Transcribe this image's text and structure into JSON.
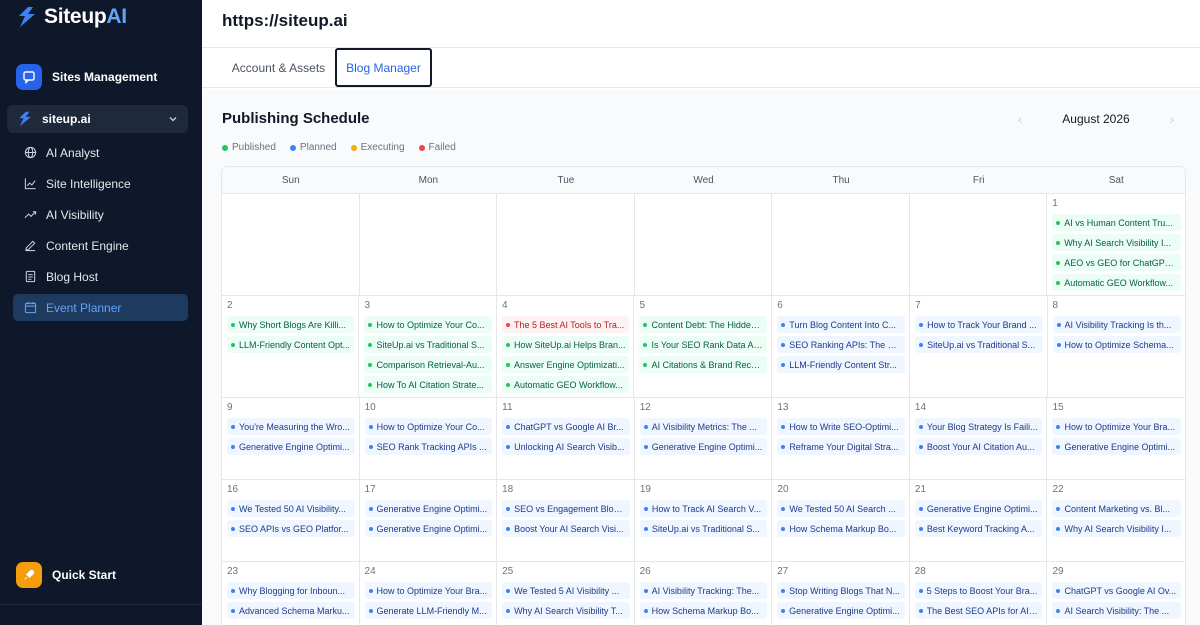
{
  "brand": {
    "name_main": "Siteup",
    "name_ai": "AI"
  },
  "sidebar": {
    "sites_management": "Sites Management",
    "site_selector": "siteup.ai",
    "items": [
      {
        "label": "AI Analyst",
        "icon": "globe-icon"
      },
      {
        "label": "Site Intelligence",
        "icon": "line-chart-icon"
      },
      {
        "label": "AI Visibility",
        "icon": "trending-up-icon"
      },
      {
        "label": "Content Engine",
        "icon": "pencil-icon"
      },
      {
        "label": "Blog Host",
        "icon": "document-icon"
      },
      {
        "label": "Event Planner",
        "icon": "calendar-icon",
        "active": true
      }
    ],
    "quick_start": "Quick Start"
  },
  "header": {
    "url": "https://siteup.ai"
  },
  "tabs": [
    {
      "label": "Account & Assets"
    },
    {
      "label": "Blog Manager",
      "active": true
    }
  ],
  "schedule": {
    "title": "Publishing Schedule",
    "month": "August 2026",
    "legend": [
      {
        "label": "Published",
        "color": "#22c55e"
      },
      {
        "label": "Planned",
        "color": "#3b82f6"
      },
      {
        "label": "Executing",
        "color": "#eab308"
      },
      {
        "label": "Failed",
        "color": "#ef4444"
      }
    ],
    "weekdays": [
      "Sun",
      "Mon",
      "Tue",
      "Wed",
      "Thu",
      "Fri",
      "Sat"
    ],
    "weeks": [
      [
        null,
        null,
        null,
        null,
        null,
        null,
        {
          "day": "1",
          "events": [
            {
              "title": "AI vs Human Content Tru...",
              "status": "published"
            },
            {
              "title": "Why AI Search Visibility I...",
              "status": "published"
            },
            {
              "title": "AEO vs GEO for ChatGPT ...",
              "status": "published"
            },
            {
              "title": "Automatic GEO Workflow...",
              "status": "published"
            }
          ]
        }
      ],
      [
        {
          "day": "2",
          "events": [
            {
              "title": "Why Short Blogs Are Killi...",
              "status": "published"
            },
            {
              "title": "LLM-Friendly Content Opt...",
              "status": "published"
            }
          ]
        },
        {
          "day": "3",
          "events": [
            {
              "title": "How to Optimize Your Co...",
              "status": "published"
            },
            {
              "title": "SiteUp.ai vs Traditional S...",
              "status": "published"
            },
            {
              "title": "Comparison Retrieval-Au...",
              "status": "published"
            },
            {
              "title": "How To AI Citation Strate...",
              "status": "published"
            }
          ]
        },
        {
          "day": "4",
          "events": [
            {
              "title": "The 5 Best AI Tools to Tra...",
              "status": "failed"
            },
            {
              "title": "How SiteUp.ai Helps Bran...",
              "status": "published"
            },
            {
              "title": "Answer Engine Optimizati...",
              "status": "published"
            },
            {
              "title": "Automatic GEO Workflow...",
              "status": "published"
            }
          ]
        },
        {
          "day": "5",
          "events": [
            {
              "title": "Content Debt: The Hidden...",
              "status": "published"
            },
            {
              "title": "Is Your SEO Rank Data Ac...",
              "status": "published"
            },
            {
              "title": "AI Citations & Brand Reco...",
              "status": "published"
            }
          ]
        },
        {
          "day": "6",
          "events": [
            {
              "title": "Turn Blog Content Into C...",
              "status": "planned"
            },
            {
              "title": "SEO Ranking APIs: The Hi...",
              "status": "planned"
            },
            {
              "title": "LLM-Friendly Content Str...",
              "status": "planned"
            }
          ]
        },
        {
          "day": "7",
          "events": [
            {
              "title": "How to Track Your Brand ...",
              "status": "planned"
            },
            {
              "title": "SiteUp.ai vs Traditional S...",
              "status": "planned"
            }
          ]
        },
        {
          "day": "8",
          "events": [
            {
              "title": "AI Visibility Tracking Is th...",
              "status": "planned"
            },
            {
              "title": "How to Optimize Schema...",
              "status": "planned"
            }
          ]
        }
      ],
      [
        {
          "day": "9",
          "events": [
            {
              "title": "You're Measuring the Wro...",
              "status": "planned"
            },
            {
              "title": "Generative Engine Optimi...",
              "status": "planned"
            }
          ]
        },
        {
          "day": "10",
          "events": [
            {
              "title": "How to Optimize Your Co...",
              "status": "planned"
            },
            {
              "title": "SEO Rank Tracking APIs ...",
              "status": "planned"
            }
          ]
        },
        {
          "day": "11",
          "events": [
            {
              "title": "ChatGPT vs Google AI Br...",
              "status": "planned"
            },
            {
              "title": "Unlocking AI Search Visib...",
              "status": "planned"
            }
          ]
        },
        {
          "day": "12",
          "events": [
            {
              "title": "AI Visibility Metrics: The ...",
              "status": "planned"
            },
            {
              "title": "Generative Engine Optimi...",
              "status": "planned"
            }
          ]
        },
        {
          "day": "13",
          "events": [
            {
              "title": "How to Write SEO-Optimi...",
              "status": "planned"
            },
            {
              "title": "Reframe Your Digital Stra...",
              "status": "planned"
            }
          ]
        },
        {
          "day": "14",
          "events": [
            {
              "title": "Your Blog Strategy Is Faili...",
              "status": "planned"
            },
            {
              "title": "Boost Your AI Citation Au...",
              "status": "planned"
            }
          ]
        },
        {
          "day": "15",
          "events": [
            {
              "title": "How to Optimize Your Bra...",
              "status": "planned"
            },
            {
              "title": "Generative Engine Optimi...",
              "status": "planned"
            }
          ]
        }
      ],
      [
        {
          "day": "16",
          "events": [
            {
              "title": "We Tested 50 AI Visibility...",
              "status": "planned"
            },
            {
              "title": "SEO APIs vs GEO Platfor...",
              "status": "planned"
            }
          ]
        },
        {
          "day": "17",
          "events": [
            {
              "title": "Generative Engine Optimi...",
              "status": "planned"
            },
            {
              "title": "Generative Engine Optimi...",
              "status": "planned"
            }
          ]
        },
        {
          "day": "18",
          "events": [
            {
              "title": "SEO vs Engagement Blog...",
              "status": "planned"
            },
            {
              "title": "Boost Your AI Search Visi...",
              "status": "planned"
            }
          ]
        },
        {
          "day": "19",
          "events": [
            {
              "title": "How to Track AI Search V...",
              "status": "planned"
            },
            {
              "title": "SiteUp.ai vs Traditional S...",
              "status": "planned"
            }
          ]
        },
        {
          "day": "20",
          "events": [
            {
              "title": "We Tested 50 AI Search ...",
              "status": "planned"
            },
            {
              "title": "How Schema Markup Bo...",
              "status": "planned"
            }
          ]
        },
        {
          "day": "21",
          "events": [
            {
              "title": "Generative Engine Optimi...",
              "status": "planned"
            },
            {
              "title": "Best Keyword Tracking A...",
              "status": "planned"
            }
          ]
        },
        {
          "day": "22",
          "events": [
            {
              "title": "Content Marketing vs. Bl...",
              "status": "planned"
            },
            {
              "title": "Why AI Search Visibility I...",
              "status": "planned"
            }
          ]
        }
      ],
      [
        {
          "day": "23",
          "events": [
            {
              "title": "Why Blogging for Inboun...",
              "status": "planned"
            },
            {
              "title": "Advanced Schema Marku...",
              "status": "planned"
            }
          ]
        },
        {
          "day": "24",
          "events": [
            {
              "title": "How to Optimize Your Bra...",
              "status": "planned"
            },
            {
              "title": "Generate LLM-Friendly M...",
              "status": "planned"
            }
          ]
        },
        {
          "day": "25",
          "events": [
            {
              "title": "We Tested 5 AI Visibility ...",
              "status": "planned"
            },
            {
              "title": "Why AI Search Visibility T...",
              "status": "planned"
            }
          ]
        },
        {
          "day": "26",
          "events": [
            {
              "title": "AI Visibility Tracking: The...",
              "status": "planned"
            },
            {
              "title": "How Schema Markup Bo...",
              "status": "planned"
            }
          ]
        },
        {
          "day": "27",
          "events": [
            {
              "title": "Stop Writing Blogs That N...",
              "status": "planned"
            },
            {
              "title": "Generative Engine Optimi...",
              "status": "planned"
            }
          ]
        },
        {
          "day": "28",
          "events": [
            {
              "title": "5 Steps to Boost Your Bra...",
              "status": "planned"
            },
            {
              "title": "The Best SEO APIs for AI ...",
              "status": "planned"
            }
          ]
        },
        {
          "day": "29",
          "events": [
            {
              "title": "ChatGPT vs Google AI Ov...",
              "status": "planned"
            },
            {
              "title": "AI Search Visibility: The ...",
              "status": "planned"
            }
          ]
        }
      ]
    ]
  }
}
